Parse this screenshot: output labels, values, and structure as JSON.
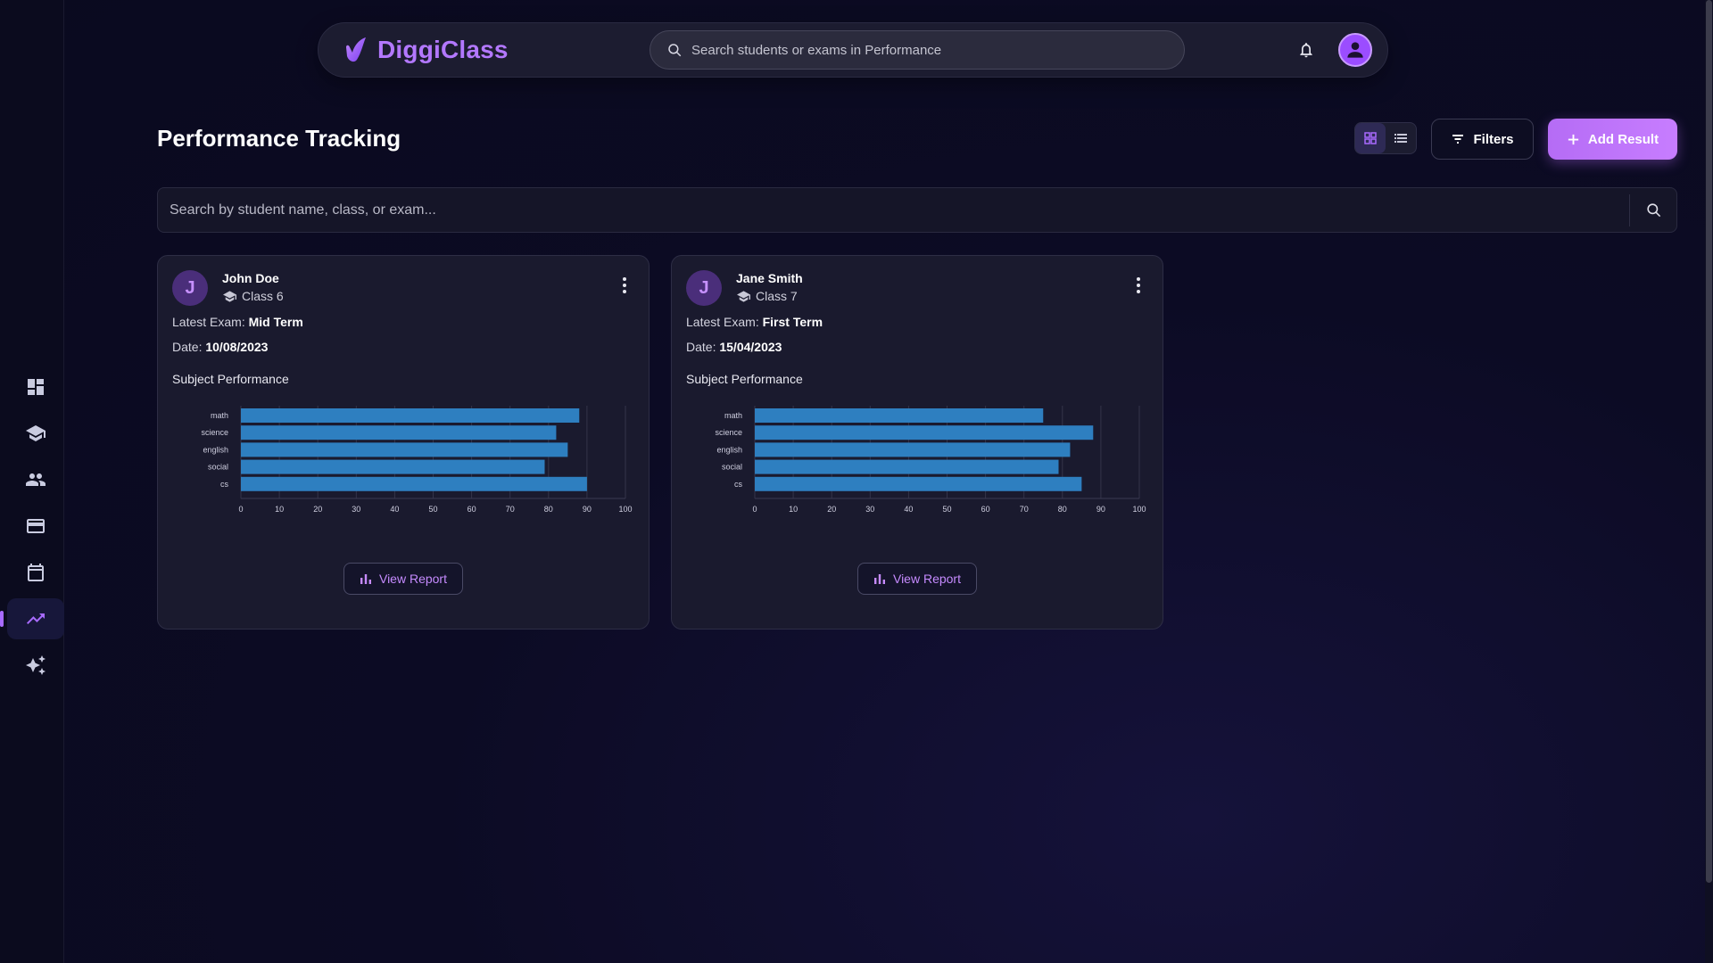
{
  "app": {
    "name": "DiggiClass"
  },
  "topbar": {
    "search_placeholder": "Search students or exams in Performance"
  },
  "sidebar": {
    "items": [
      {
        "icon": "dashboard-icon",
        "active": false
      },
      {
        "icon": "graduation-cap-icon",
        "active": false
      },
      {
        "icon": "people-icon",
        "active": false
      },
      {
        "icon": "credit-card-icon",
        "active": false
      },
      {
        "icon": "calendar-icon",
        "active": false
      },
      {
        "icon": "trending-up-icon",
        "active": true
      },
      {
        "icon": "sparkle-icon",
        "active": false
      }
    ]
  },
  "page": {
    "title": "Performance Tracking",
    "filters_label": "Filters",
    "add_label": "Add Result",
    "search_placeholder": "Search by student name, class, or exam..."
  },
  "labels": {
    "latest_exam": "Latest Exam:",
    "date": "Date:",
    "subject_performance": "Subject Performance",
    "view_report": "View Report"
  },
  "students": [
    {
      "initial": "J",
      "name": "John Doe",
      "class": "Class 6",
      "exam": "Mid Term",
      "date": "10/08/2023"
    },
    {
      "initial": "J",
      "name": "Jane Smith",
      "class": "Class 7",
      "exam": "First Term",
      "date": "15/04/2023"
    }
  ],
  "colors": {
    "accent": "#b378ff",
    "bar": "#2e7fc0",
    "background": "#0c0b24",
    "card": "#1a1a2e"
  },
  "chart_data": [
    {
      "type": "bar",
      "orientation": "horizontal",
      "categories": [
        "math",
        "science",
        "english",
        "social",
        "cs"
      ],
      "values": [
        88,
        82,
        85,
        79,
        90
      ],
      "xlim": [
        0,
        100
      ],
      "ticks": [
        0,
        10,
        20,
        30,
        40,
        50,
        60,
        70,
        80,
        90,
        100
      ],
      "grid": true
    },
    {
      "type": "bar",
      "orientation": "horizontal",
      "categories": [
        "math",
        "science",
        "english",
        "social",
        "cs"
      ],
      "values": [
        75,
        88,
        82,
        79,
        85
      ],
      "xlim": [
        0,
        100
      ],
      "ticks": [
        0,
        10,
        20,
        30,
        40,
        50,
        60,
        70,
        80,
        90,
        100
      ],
      "grid": true
    }
  ]
}
